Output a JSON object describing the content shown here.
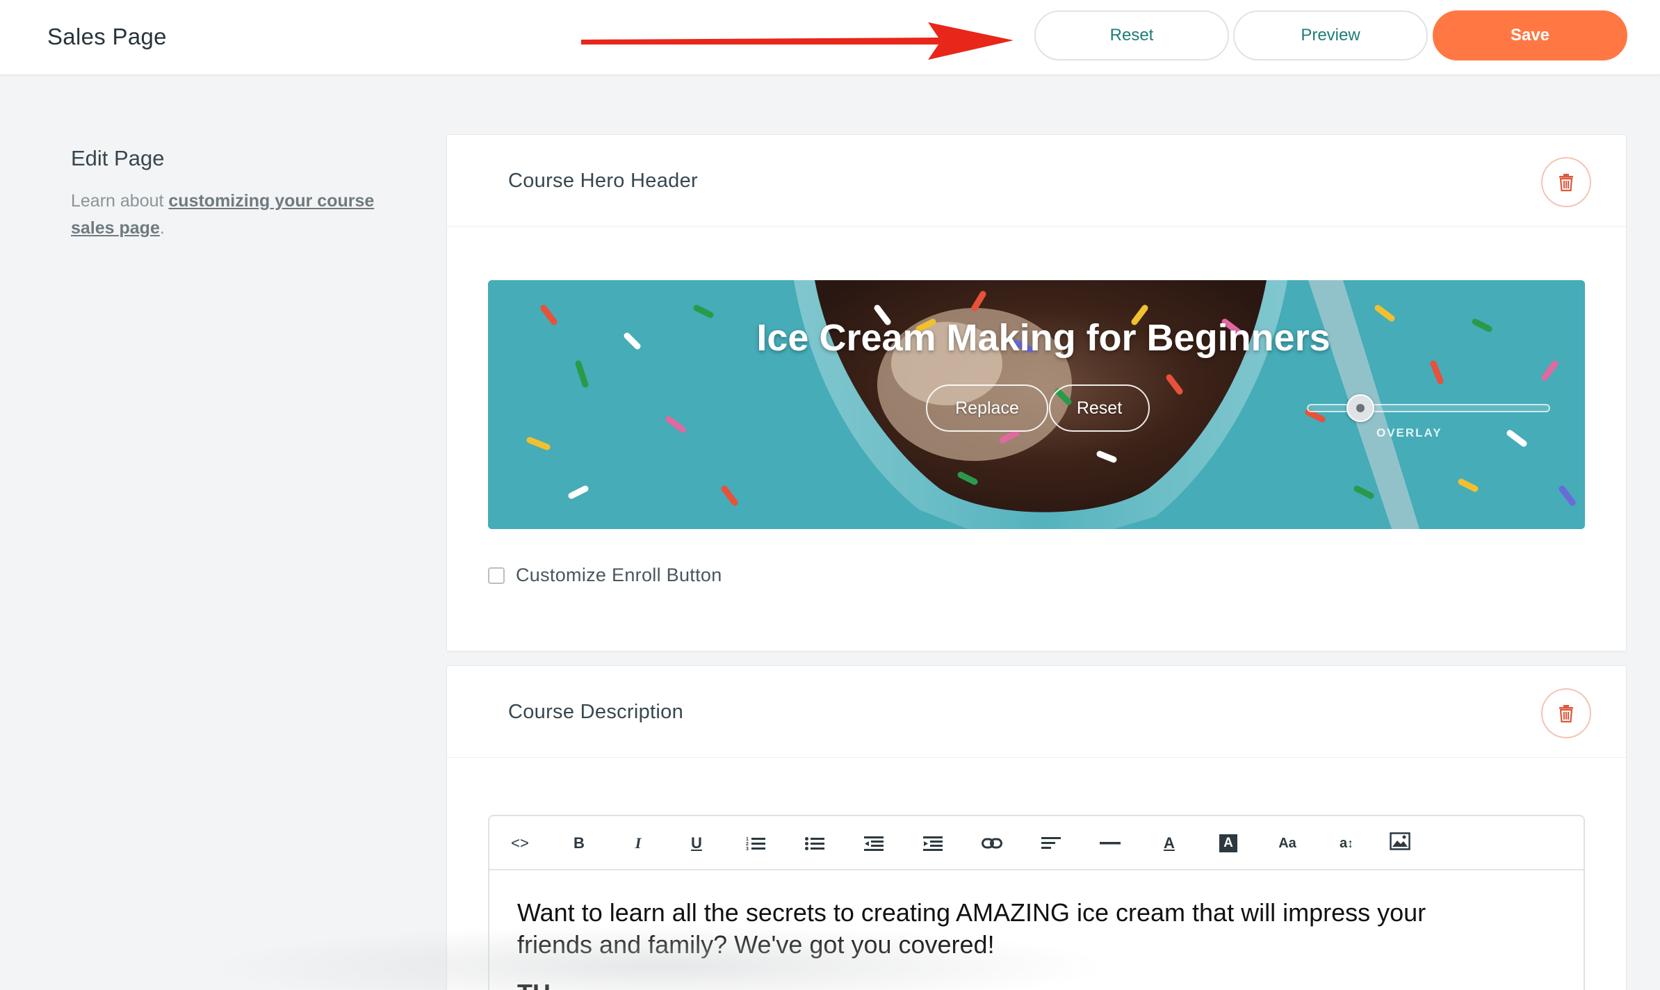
{
  "header": {
    "title": "Sales Page",
    "reset_label": "Reset",
    "preview_label": "Preview",
    "save_label": "Save"
  },
  "sidebar": {
    "title": "Edit Page",
    "help_prefix": "Learn about ",
    "help_link": "customizing your course sales page",
    "help_suffix": "."
  },
  "hero_section": {
    "title": "Course Hero Header",
    "hero_text": "Ice Cream Making for Beginners",
    "replace_label": "Replace",
    "reset_label": "Reset",
    "overlay_label": "OVERLAY",
    "overlay_level": 0.22,
    "customize_enroll_label": "Customize Enroll Button",
    "customize_enroll_checked": false
  },
  "description_section": {
    "title": "Course Description",
    "toolbar": [
      "code-view",
      "bold",
      "italic",
      "underline",
      "ordered-list",
      "unordered-list",
      "outdent",
      "indent",
      "link",
      "align-left",
      "horizontal-rule",
      "font-color",
      "background-color",
      "font-size",
      "line-height",
      "insert-image"
    ],
    "toolbar_labels": {
      "code": "<>",
      "bold": "B",
      "italic": "I",
      "underline": "U",
      "font_color": "A",
      "bg_color": "A",
      "font_size": "Aa",
      "line_height": "a"
    },
    "body_text": "Want to learn all the secrets to creating AMAZING ice cream that will impress your friends and family? We've got you covered!",
    "body_next_line": "TH"
  },
  "colors": {
    "accent": "#ff7843",
    "teal_text": "#1d7d78",
    "trash": "#e0583a",
    "arrow": "#e8261a"
  }
}
